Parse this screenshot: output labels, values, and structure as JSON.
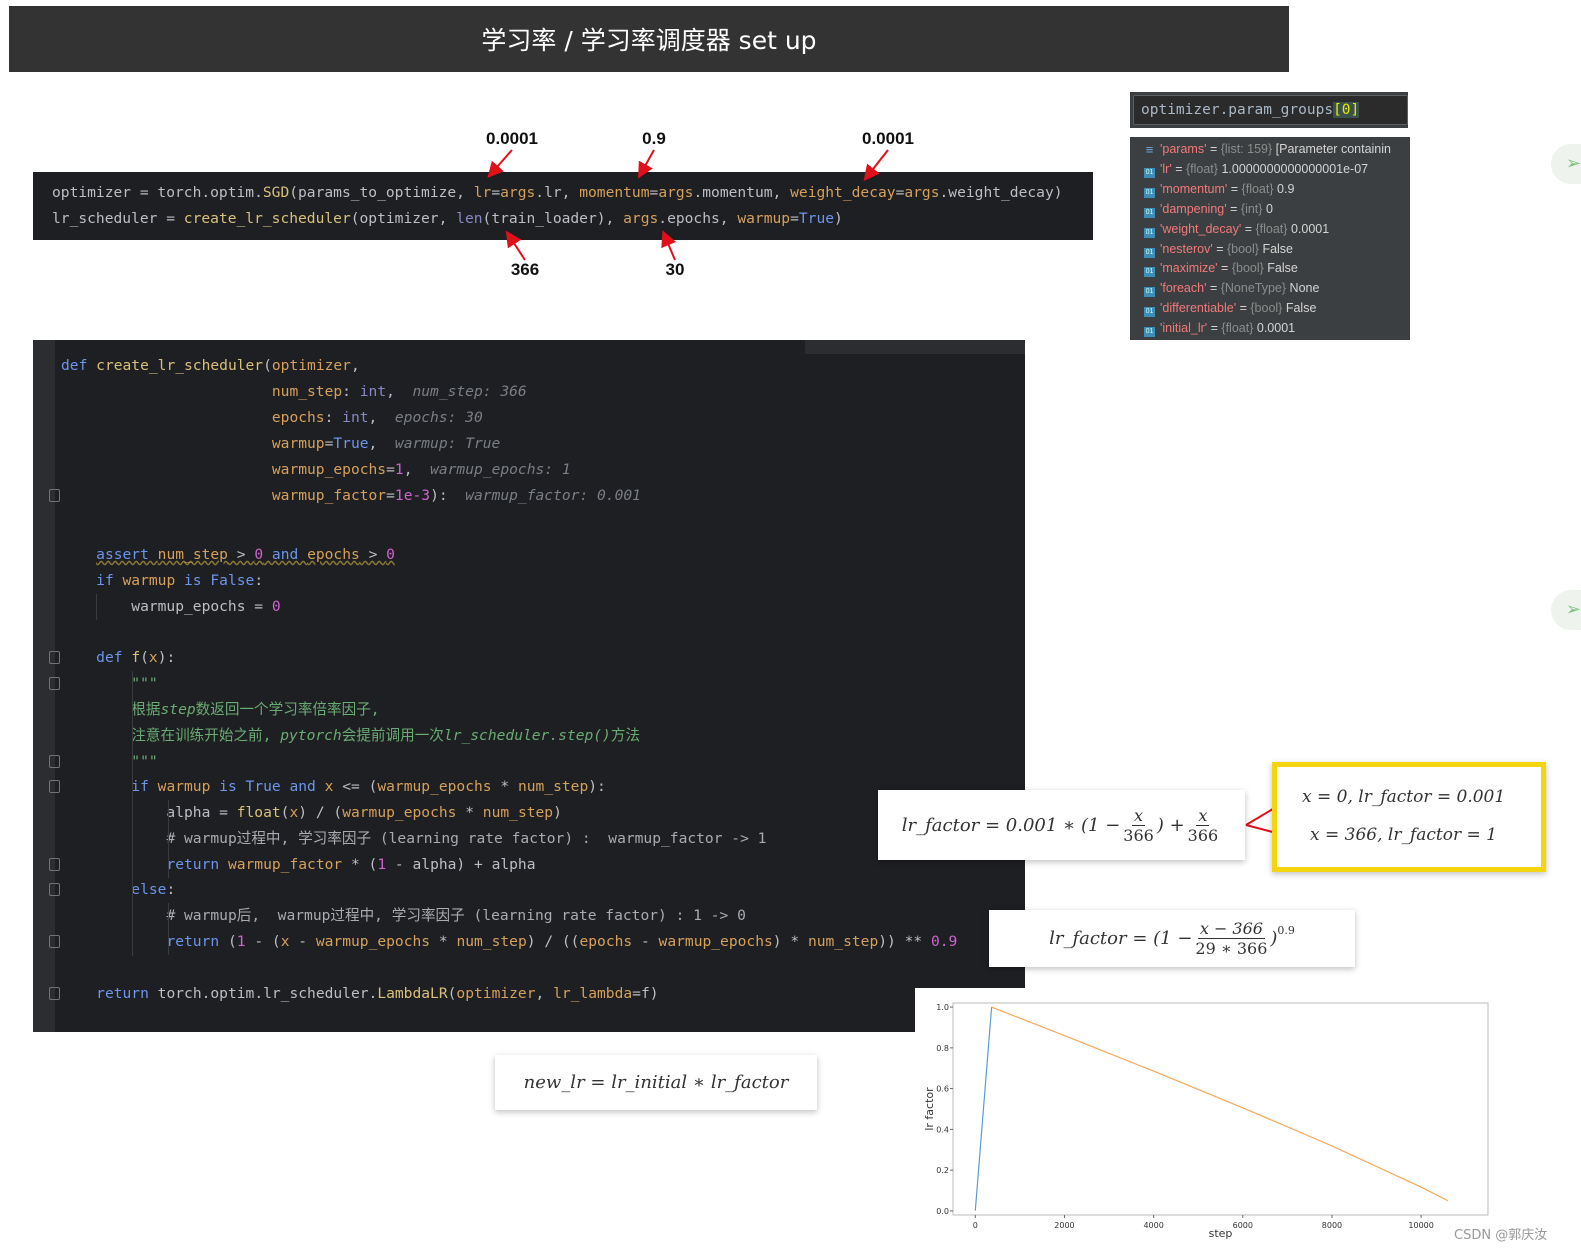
{
  "title": "学习率 / 学习率调度器 set up",
  "top_code": {
    "lines": [
      [
        [
          "d",
          "optimizer = torch.optim."
        ],
        [
          "f",
          "SGD"
        ],
        [
          "d",
          "(params_to_optimize, "
        ],
        [
          "p",
          "lr"
        ],
        [
          "d",
          "="
        ],
        [
          "p",
          "args"
        ],
        [
          "d",
          ".lr, "
        ],
        [
          "p",
          "momentum"
        ],
        [
          "d",
          "="
        ],
        [
          "p",
          "args"
        ],
        [
          "d",
          ".momentum, "
        ],
        [
          "p",
          "weight_decay"
        ],
        [
          "d",
          "="
        ],
        [
          "p",
          "args"
        ],
        [
          "d",
          ".weight_decay)"
        ]
      ],
      [
        [
          "d",
          "lr_scheduler = "
        ],
        [
          "f",
          "create_lr_scheduler"
        ],
        [
          "d",
          "(optimizer, "
        ],
        [
          "b",
          "len"
        ],
        [
          "d",
          "(train_loader), "
        ],
        [
          "p",
          "args"
        ],
        [
          "d",
          ".epochs, "
        ],
        [
          "p",
          "warmup"
        ],
        [
          "d",
          "="
        ],
        [
          "k",
          "True"
        ],
        [
          "d",
          ")"
        ]
      ]
    ],
    "annotations_above": [
      "0.0001",
      "0.9",
      "0.0001"
    ],
    "annotations_below": [
      "366",
      "30"
    ]
  },
  "code": {
    "lines": [
      [
        [
          "k",
          "def "
        ],
        [
          "f",
          "create_lr_scheduler"
        ],
        [
          "d",
          "("
        ],
        [
          "p",
          "optimizer"
        ],
        [
          "d",
          ","
        ]
      ],
      [
        [
          "d",
          "                        "
        ],
        [
          "p",
          "num_step"
        ],
        [
          "d",
          ": "
        ],
        [
          "b",
          "int"
        ],
        [
          "d",
          ",  "
        ],
        [
          "h",
          "num_step: 366"
        ]
      ],
      [
        [
          "d",
          "                        "
        ],
        [
          "p",
          "epochs"
        ],
        [
          "d",
          ": "
        ],
        [
          "b",
          "int"
        ],
        [
          "d",
          ",  "
        ],
        [
          "h",
          "epochs: 30"
        ]
      ],
      [
        [
          "d",
          "                        "
        ],
        [
          "p",
          "warmup"
        ],
        [
          "d",
          "="
        ],
        [
          "k",
          "True"
        ],
        [
          "d",
          ",  "
        ],
        [
          "h",
          "warmup: True"
        ]
      ],
      [
        [
          "d",
          "                        "
        ],
        [
          "p",
          "warmup_epochs"
        ],
        [
          "d",
          "="
        ],
        [
          "n",
          "1"
        ],
        [
          "d",
          ",  "
        ],
        [
          "h",
          "warmup_epochs: 1"
        ]
      ],
      [
        [
          "d",
          "                        "
        ],
        [
          "p",
          "warmup_factor"
        ],
        [
          "d",
          "="
        ],
        [
          "n",
          "1e-3"
        ],
        [
          "d",
          "):  "
        ],
        [
          "h",
          "warmup_factor: 0.001"
        ]
      ],
      [],
      [
        [
          "d",
          "    "
        ],
        [
          "k u",
          "assert "
        ],
        [
          "p u",
          "num_step"
        ],
        [
          "d u",
          " > "
        ],
        [
          "n u",
          "0"
        ],
        [
          "k u",
          " and "
        ],
        [
          "p u",
          "epochs"
        ],
        [
          "d u",
          " > "
        ],
        [
          "n u",
          "0"
        ]
      ],
      [
        [
          "d",
          "    "
        ],
        [
          "k",
          "if "
        ],
        [
          "p",
          "warmup"
        ],
        [
          "k",
          " is "
        ],
        [
          "k",
          "False"
        ],
        [
          "d",
          ":"
        ]
      ],
      [
        [
          "d",
          "        warmup_epochs = "
        ],
        [
          "n",
          "0"
        ]
      ],
      [],
      [
        [
          "d",
          "    "
        ],
        [
          "k",
          "def "
        ],
        [
          "f",
          "f"
        ],
        [
          "d",
          "("
        ],
        [
          "p",
          "x"
        ],
        [
          "d",
          "):"
        ]
      ],
      [
        [
          "d",
          "        "
        ],
        [
          "s",
          "\"\"\""
        ]
      ],
      [
        [
          "d",
          "        "
        ],
        [
          "s",
          "根据"
        ],
        [
          "si",
          "step"
        ],
        [
          "s",
          "数返回一个学习率倍率因子,"
        ]
      ],
      [
        [
          "d",
          "        "
        ],
        [
          "s",
          "注意在训练开始之前, "
        ],
        [
          "si",
          "pytorch"
        ],
        [
          "s",
          "会提前调用一次"
        ],
        [
          "si",
          "lr_scheduler.step()"
        ],
        [
          "s",
          "方法"
        ]
      ],
      [
        [
          "d",
          "        "
        ],
        [
          "s",
          "\"\"\""
        ]
      ],
      [
        [
          "d",
          "        "
        ],
        [
          "k",
          "if "
        ],
        [
          "p",
          "warmup"
        ],
        [
          "k",
          " is "
        ],
        [
          "k",
          "True"
        ],
        [
          "k",
          " and "
        ],
        [
          "p",
          "x"
        ],
        [
          "d",
          " <= ("
        ],
        [
          "p",
          "warmup_epochs"
        ],
        [
          "d",
          " * "
        ],
        [
          "p",
          "num_step"
        ],
        [
          "d",
          "):"
        ]
      ],
      [
        [
          "d",
          "            alpha = "
        ],
        [
          "f",
          "float"
        ],
        [
          "d",
          "("
        ],
        [
          "p",
          "x"
        ],
        [
          "d",
          ") / ("
        ],
        [
          "p",
          "warmup_epochs"
        ],
        [
          "d",
          " * "
        ],
        [
          "p",
          "num_step"
        ],
        [
          "d",
          ")"
        ]
      ],
      [
        [
          "d",
          "            "
        ],
        [
          "c",
          "# warmup过程中, 学习率因子 (learning rate factor) :  warmup_factor -> 1"
        ]
      ],
      [
        [
          "d",
          "            "
        ],
        [
          "k",
          "return "
        ],
        [
          "p",
          "warmup_factor"
        ],
        [
          "d",
          " * ("
        ],
        [
          "n",
          "1"
        ],
        [
          "d",
          " - alpha) + alpha"
        ]
      ],
      [
        [
          "d",
          "        "
        ],
        [
          "k",
          "else"
        ],
        [
          "d",
          ":"
        ]
      ],
      [
        [
          "d",
          "            "
        ],
        [
          "c",
          "# warmup后,  warmup过程中, 学习率因子 (learning rate factor) : 1 -> 0"
        ]
      ],
      [
        [
          "d",
          "            "
        ],
        [
          "k",
          "return "
        ],
        [
          "d",
          "("
        ],
        [
          "n",
          "1"
        ],
        [
          "d",
          " - ("
        ],
        [
          "p",
          "x"
        ],
        [
          "d",
          " - "
        ],
        [
          "p",
          "warmup_epochs"
        ],
        [
          "d",
          " * "
        ],
        [
          "p",
          "num_step"
        ],
        [
          "d",
          ") / (("
        ],
        [
          "p",
          "epochs"
        ],
        [
          "d",
          " - "
        ],
        [
          "p",
          "warmup_epochs"
        ],
        [
          "d",
          ") * "
        ],
        [
          "p",
          "num_step"
        ],
        [
          "d",
          ")) ** "
        ],
        [
          "n",
          "0.9"
        ]
      ],
      [],
      [
        [
          "d",
          "    "
        ],
        [
          "k",
          "return "
        ],
        [
          "d",
          "torch.optim.lr_scheduler."
        ],
        [
          "f",
          "LambdaLR"
        ],
        [
          "d",
          "("
        ],
        [
          "p",
          "optimizer"
        ],
        [
          "d",
          ", "
        ],
        [
          "p",
          "lr_lambda"
        ],
        [
          "d",
          "=f)"
        ]
      ]
    ]
  },
  "debugger": {
    "expression": "optimizer.param_groups[0]",
    "expression_base": "optimizer.param_groups",
    "expression_index": "[0]",
    "rows": [
      {
        "icon": "list-icon",
        "key": "'params'",
        "type": "{list: 159}",
        "value": "[Parameter containin"
      },
      {
        "icon": "field-icon",
        "key": "'lr'",
        "type": "{float}",
        "value": "1.0000000000000001e-07"
      },
      {
        "icon": "field-icon",
        "key": "'momentum'",
        "type": "{float}",
        "value": "0.9"
      },
      {
        "icon": "field-icon",
        "key": "'dampening'",
        "type": "{int}",
        "value": "0"
      },
      {
        "icon": "field-icon",
        "key": "'weight_decay'",
        "type": "{float}",
        "value": "0.0001"
      },
      {
        "icon": "field-icon",
        "key": "'nesterov'",
        "type": "{bool}",
        "value": "False"
      },
      {
        "icon": "field-icon",
        "key": "'maximize'",
        "type": "{bool}",
        "value": "False"
      },
      {
        "icon": "field-icon",
        "key": "'foreach'",
        "type": "{NoneType}",
        "value": "None"
      },
      {
        "icon": "field-icon",
        "key": "'differentiable'",
        "type": "{bool}",
        "value": "False"
      },
      {
        "icon": "field-icon",
        "key": "'initial_lr'",
        "type": "{float}",
        "value": "0.0001"
      }
    ]
  },
  "formulas": {
    "warmup": {
      "lhs": "lr_factor = 0.001 ∗ (1 −",
      "num1": "x",
      "den1": "366",
      "mid": ") +",
      "num2": "x",
      "den2": "366"
    },
    "boundary": {
      "line1": "x = 0,  lr_factor = 0.001",
      "line2": "x = 366,  lr_factor = 1"
    },
    "decay": {
      "lhs": "lr_factor = (1 −",
      "num": "x − 366",
      "den": "29 ∗ 366",
      "rhs": ")",
      "exp": "0.9"
    },
    "new_lr": "new_lr = lr_initial ∗ lr_factor"
  },
  "colors": {
    "arrow": "#e0101a",
    "highlight": "#f5d50f",
    "warmup_line": "#5b9bd5",
    "decay_line": "#f5a85a"
  },
  "chart_data": {
    "type": "line",
    "xlabel": "step",
    "ylabel": "lr factor",
    "xlim": [
      -500,
      11500
    ],
    "ylim": [
      -0.02,
      1.02
    ],
    "xticks": [
      "0",
      "2000",
      "4000",
      "6000",
      "8000",
      "10000"
    ],
    "yticks": [
      "0.0",
      "0.2",
      "0.4",
      "0.6",
      "0.8",
      "1.0"
    ],
    "grid": false,
    "series": [
      {
        "x": [
          0,
          366
        ],
        "y": [
          0.001,
          1.0
        ],
        "color": "#5b9bd5"
      },
      {
        "x": [
          366,
          2000,
          4000,
          6000,
          8000,
          10000,
          10600
        ],
        "y": [
          1.0,
          0.86,
          0.686,
          0.506,
          0.319,
          0.117,
          0.05
        ],
        "color": "#f5a85a"
      }
    ]
  },
  "watermark": "CSDN @郭庆汝",
  "side_icons": [
    "send-icon",
    "send-icon"
  ]
}
